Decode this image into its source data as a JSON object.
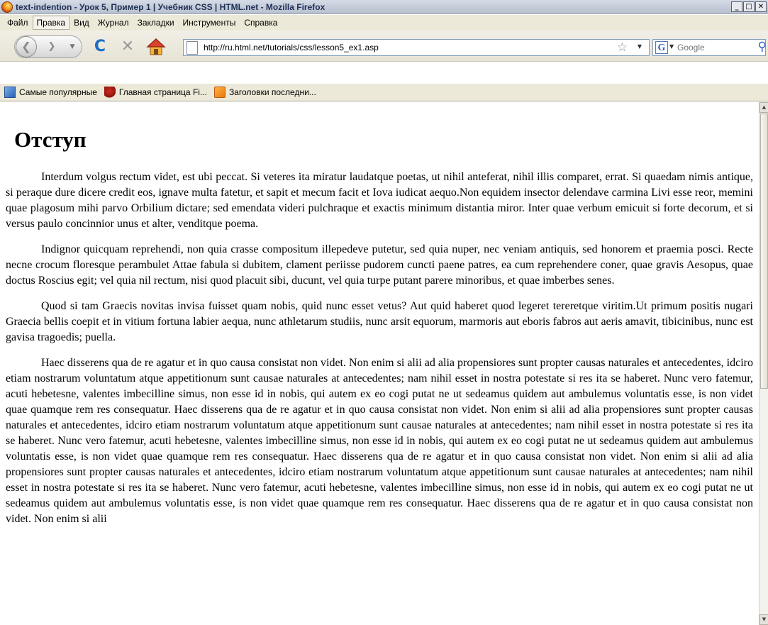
{
  "window": {
    "title": "text-indention - Урок 5, Пример 1 | Учебник CSS | HTML.net - Mozilla Firefox",
    "minimize_glyph": "_",
    "maximize_glyph": "□",
    "close_glyph": "✕"
  },
  "menu": {
    "items": [
      {
        "label": "Файл"
      },
      {
        "label": "Правка"
      },
      {
        "label": "Вид"
      },
      {
        "label": "Журнал"
      },
      {
        "label": "Закладки"
      },
      {
        "label": "Инструменты"
      },
      {
        "label": "Справка"
      }
    ]
  },
  "toolbar": {
    "back_icon": "back-arrow-icon",
    "forward_icon": "forward-arrow-icon",
    "reload_glyph": "C",
    "stop_glyph": "✕",
    "url": "http://ru.html.net/tutorials/css/lesson5_ex1.asp",
    "search_engine_glyph": "G",
    "search_placeholder": "Google"
  },
  "bookmarks": [
    {
      "label": "Самые популярные",
      "icon": "popular-icon"
    },
    {
      "label": "Главная страница Fi...",
      "icon": "firefox-icon"
    },
    {
      "label": "Заголовки последни...",
      "icon": "rss-icon"
    }
  ],
  "page": {
    "heading": "Отступ",
    "paragraphs": [
      "Interdum volgus rectum videt, est ubi peccat. Si veteres ita miratur laudatque poetas, ut nihil anteferat, nihil illis comparet, errat. Si quaedam nimis antique, si peraque dure dicere credit eos, ignave multa fatetur, et sapit et mecum facit et Iova iudicat aequo.Non equidem insector delendave carmina Livi esse reor, memini quae plagosum mihi parvo Orbilium dictare; sed emendata videri pulchraque et exactis minimum distantia miror. Inter quae verbum emicuit si forte decorum, et si versus paulo concinnior unus et alter, venditque poema.",
      "Indignor quicquam reprehendi, non quia crasse compositum illepedeve putetur, sed quia nuper, nec veniam antiquis, sed honorem et praemia posci. Recte necne crocum floresque perambulet Attae fabula si dubitem, clament periisse pudorem cuncti paene patres, ea cum reprehendere coner, quae gravis Aesopus, quae doctus Roscius egit; vel quia nil rectum, nisi quod placuit sibi, ducunt, vel quia turpe putant parere minoribus, et quae imberbes senes.",
      "Quod si tam Graecis novitas invisa fuisset quam nobis, quid nunc esset vetus? Aut quid haberet quod legeret tereretque viritim.Ut primum positis nugari Graecia bellis coepit et in vitium fortuna labier aequa, nunc athletarum studiis, nunc arsit equorum, marmoris aut eboris fabros aut aeris amavit, tibicinibus, nunc est gavisa tragoedis; puella.",
      "Haec disserens qua de re agatur et in quo causa consistat non videt. Non enim si alii ad alia propensiores sunt propter causas naturales et antecedentes, idciro etiam nostrarum voluntatum atque appetitionum sunt causae naturales at antecedentes; nam nihil esset in nostra potestate si res ita se haberet. Nunc vero fatemur, acuti hebetesne, valentes imbecilline simus, non esse id in nobis, qui autem ex eo cogi putat ne ut sedeamus quidem aut ambulemus voluntatis esse, is non videt quae quamque rem res consequatur. Haec disserens qua de re agatur et in quo causa consistat non videt. Non enim si alii ad alia propensiores sunt propter causas naturales et antecedentes, idciro etiam nostrarum voluntatum atque appetitionum sunt causae naturales at antecedentes; nam nihil esset in nostra potestate si res ita se haberet. Nunc vero fatemur, acuti hebetesne, valentes imbecilline simus, non esse id in nobis, qui autem ex eo cogi putat ne ut sedeamus quidem aut ambulemus voluntatis esse, is non videt quae quamque rem res consequatur. Haec disserens qua de re agatur et in quo causa consistat non videt. Non enim si alii ad alia propensiores sunt propter causas naturales et antecedentes, idciro etiam nostrarum voluntatum atque appetitionum sunt causae naturales at antecedentes; nam nihil esset in nostra potestate si res ita se haberet. Nunc vero fatemur, acuti hebetesne, valentes imbecilline simus, non esse id in nobis, qui autem ex eo cogi putat ne ut sedeamus quidem aut ambulemus voluntatis esse, is non videt quae quamque rem res consequatur. Haec disserens qua de re agatur et in quo causa consistat non videt. Non enim si alii"
    ]
  },
  "scrollbar": {
    "up_glyph": "▲",
    "down_glyph": "▼"
  }
}
